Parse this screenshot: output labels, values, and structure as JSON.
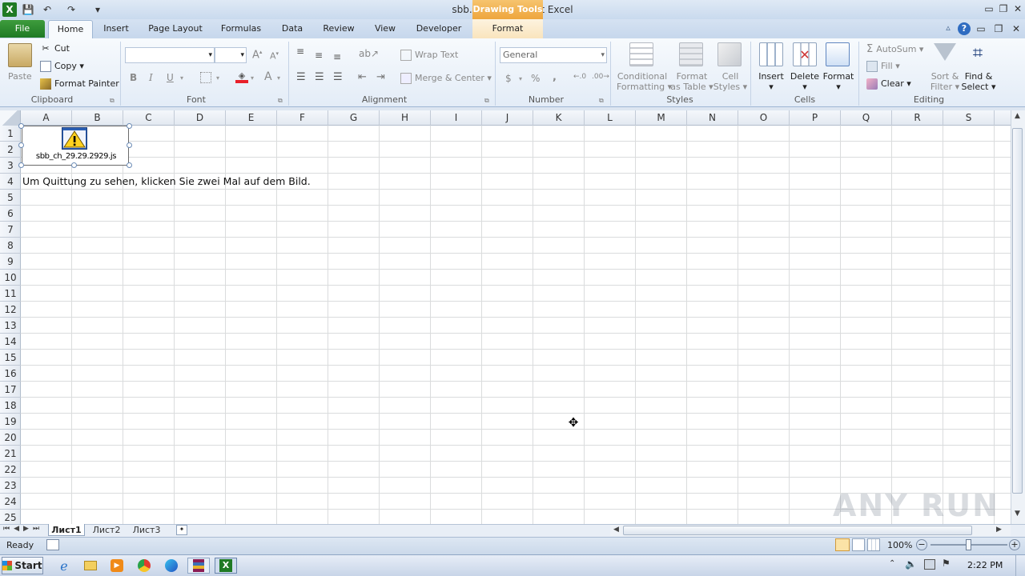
{
  "window": {
    "title": "sbb.xlsx - Microsoft Excel",
    "contextual_label": "Drawing Tools",
    "controls": {
      "minimize": "▭",
      "restore": "❐",
      "close": "✕"
    }
  },
  "qat": {
    "save": "💾",
    "undo": "↶",
    "redo": "↷",
    "customize": "▾"
  },
  "tabs": [
    {
      "label": "File"
    },
    {
      "label": "Home"
    },
    {
      "label": "Insert"
    },
    {
      "label": "Page Layout"
    },
    {
      "label": "Formulas"
    },
    {
      "label": "Data"
    },
    {
      "label": "Review"
    },
    {
      "label": "View"
    },
    {
      "label": "Developer"
    },
    {
      "label": "Format"
    }
  ],
  "ribbon": {
    "clipboard": {
      "label": "Clipboard",
      "paste": "Paste",
      "cut": "Cut",
      "copy": "Copy",
      "format_painter": "Format Painter"
    },
    "font": {
      "label": "Font",
      "font_name": "",
      "font_size": "",
      "bold": "B",
      "italic": "I",
      "underline": "U"
    },
    "alignment": {
      "label": "Alignment",
      "wrap_text": "Wrap Text",
      "merge_center": "Merge & Center"
    },
    "number": {
      "label": "Number",
      "format": "General",
      "currency": "$",
      "percent": "%",
      "comma": ","
    },
    "styles": {
      "label": "Styles",
      "conditional": [
        "Conditional",
        "Formatting"
      ],
      "format_table": [
        "Format",
        "as Table"
      ],
      "cell_styles": [
        "Cell",
        "Styles"
      ]
    },
    "cells": {
      "label": "Cells",
      "insert": "Insert",
      "delete": "Delete",
      "format": "Format"
    },
    "editing": {
      "label": "Editing",
      "autosum": "AutoSum",
      "fill": "Fill",
      "clear": "Clear",
      "sort_filter": [
        "Sort &",
        "Filter"
      ],
      "find_select": [
        "Find &",
        "Select"
      ]
    }
  },
  "grid": {
    "columns": [
      "A",
      "B",
      "C",
      "D",
      "E",
      "F",
      "G",
      "H",
      "I",
      "J",
      "K",
      "L",
      "M",
      "N",
      "O",
      "P",
      "Q",
      "R",
      "S"
    ],
    "rows": [
      "1",
      "2",
      "3",
      "4",
      "5",
      "6",
      "7",
      "8",
      "9",
      "10",
      "11",
      "12",
      "13",
      "14",
      "15",
      "16",
      "17",
      "18",
      "19",
      "20",
      "21",
      "22",
      "23",
      "24",
      "25"
    ],
    "cell_a4": "Um Quittung zu sehen, klicken Sie zwei Mal auf dem Bild.",
    "embedded_object_label": "sbb_ch_29.29.2929.js",
    "embedded_icon": "warning-icon"
  },
  "sheets": [
    {
      "label": "Лист1",
      "active": true
    },
    {
      "label": "Лист2",
      "active": false
    },
    {
      "label": "Лист3",
      "active": false
    }
  ],
  "status": {
    "ready": "Ready",
    "zoom": "100%",
    "zoom_level": 0.5
  },
  "taskbar": {
    "start": "Start",
    "clock": "2:22 PM"
  },
  "watermark": "ANY RUN",
  "colors": {
    "excel_green": "#1f7a24",
    "drawing_tools": "#eea53d",
    "ribbon_bg": "#e3ecf7"
  }
}
